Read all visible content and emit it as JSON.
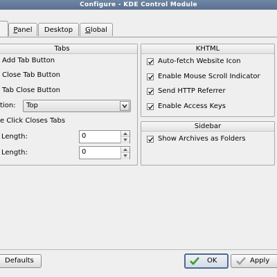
{
  "window": {
    "title": "Configure - KDE Control Module"
  },
  "tabs": [
    {
      "label": "",
      "active": true
    },
    {
      "label": "Panel",
      "active": false
    },
    {
      "label": "Desktop",
      "active": false
    },
    {
      "label": "Global",
      "active": false
    }
  ],
  "tabs_group": {
    "title": "Tabs",
    "add_tab_button": "Add Tab Button",
    "close_tab_button": "Close Tab Button",
    "tab_close_button": "Tab Close Button",
    "position_label": "tion:",
    "position_value": "Top",
    "middle_click": "e Click Closes Tabs",
    "length_label_1": "Length:",
    "length_value_1": "0",
    "length_label_2": "Length:",
    "length_value_2": "0"
  },
  "khtml_group": {
    "title": "KHTML",
    "items": [
      {
        "label": "Auto-fetch Website Icon",
        "checked": true
      },
      {
        "label": "Enable Mouse Scroll Indicator",
        "checked": true
      },
      {
        "label": "Send HTTP Referrer",
        "checked": true
      },
      {
        "label": "Enable Access Keys",
        "checked": true
      }
    ]
  },
  "sidebar_group": {
    "title": "Sidebar",
    "items": [
      {
        "label": "Show Archives as Folders",
        "checked": true
      }
    ]
  },
  "buttons": {
    "defaults": "Defaults",
    "ok": "OK",
    "apply": "Apply"
  },
  "colors": {
    "titlebar": "#5f7797",
    "default_button_border": "#4c6a92",
    "ok_icon": "#3a9a2a"
  }
}
